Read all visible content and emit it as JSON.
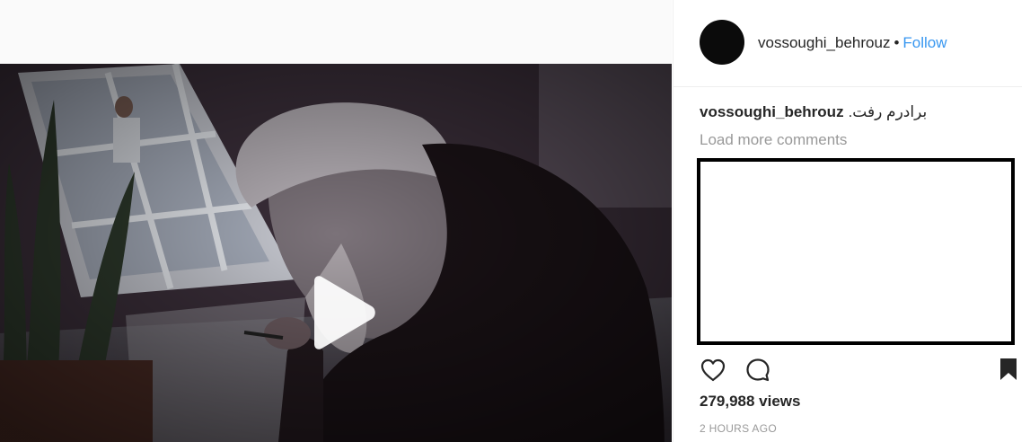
{
  "post": {
    "username": "vossoughi_behrouz",
    "separator": "•",
    "follow_label": "Follow",
    "caption_username": "vossoughi_behrouz",
    "caption_text": "برادرم رفت.",
    "load_more_label": "Load more comments",
    "views": "279,988 views",
    "timestamp": "2 HOURS AGO"
  },
  "icons": {
    "play": "play-icon",
    "like": "heart-icon",
    "comment": "comment-icon",
    "save": "bookmark-icon"
  },
  "colors": {
    "follow": "#3897f0",
    "muted_text": "#999999",
    "primary_text": "#262626",
    "redaction_border": "#000000"
  }
}
